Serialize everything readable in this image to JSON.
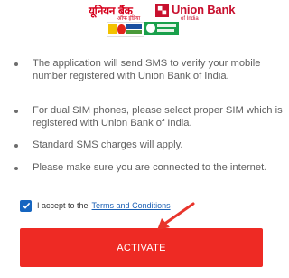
{
  "header": {
    "logo_hindi": "यूनियन बैंक",
    "logo_hindi_sub": "ऑफ इंडिया",
    "logo_english": "Union Bank",
    "logo_english_sub": "of India",
    "badges": [
      "andhra-bank-badge-icon",
      "corporation-bank-badge-icon"
    ],
    "brand_color": "#d6001c"
  },
  "instructions": [
    "The application will send SMS to verify your mobile number registered with Union Bank of India.",
    "For dual SIM phones, please select proper SIM which is registered with Union Bank of India.",
    "Standard SMS charges will apply.",
    "Please make sure you are connected to the internet."
  ],
  "accept": {
    "checked": true,
    "label": "I accept to the",
    "link_text": "Terms and Conditions"
  },
  "activate_button": {
    "label": "ACTIVATE",
    "color": "#ee2a24"
  },
  "annotation": {
    "arrow_color": "#e8352c",
    "icon": "red-arrow-icon"
  }
}
